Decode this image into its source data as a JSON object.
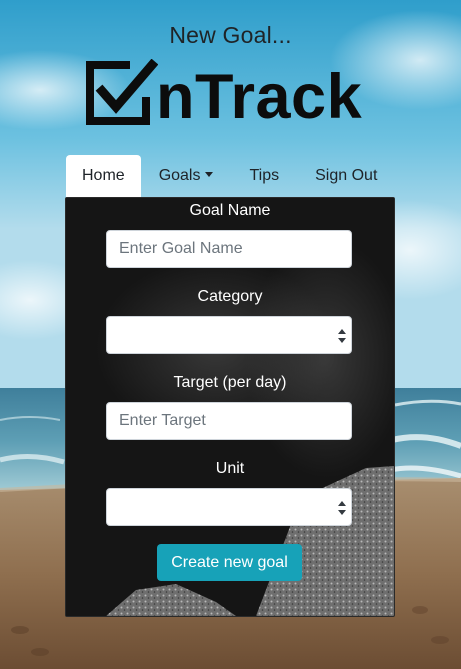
{
  "page": {
    "heading": "New Goal...",
    "logo_text": "nTrack"
  },
  "nav": {
    "items": [
      {
        "label": "Home",
        "active": true
      },
      {
        "label": "Goals",
        "dropdown": true
      },
      {
        "label": "Tips"
      },
      {
        "label": "Sign Out"
      }
    ]
  },
  "form": {
    "goal_name": {
      "label": "Goal Name",
      "placeholder": "Enter Goal Name",
      "value": ""
    },
    "category": {
      "label": "Category",
      "selected": ""
    },
    "target": {
      "label": "Target (per day)",
      "placeholder": "Enter Target",
      "value": ""
    },
    "unit": {
      "label": "Unit",
      "selected": ""
    },
    "submit_label": "Create new goal"
  },
  "colors": {
    "accent": "#17a2b8",
    "card_background": "#141414",
    "nav_active_background": "#ffffff",
    "text_dark": "#1e2328"
  },
  "icons": {
    "logo": "checkbox-check-icon",
    "dropdown": "caret-down-icon",
    "select": "select-arrows-icon"
  }
}
